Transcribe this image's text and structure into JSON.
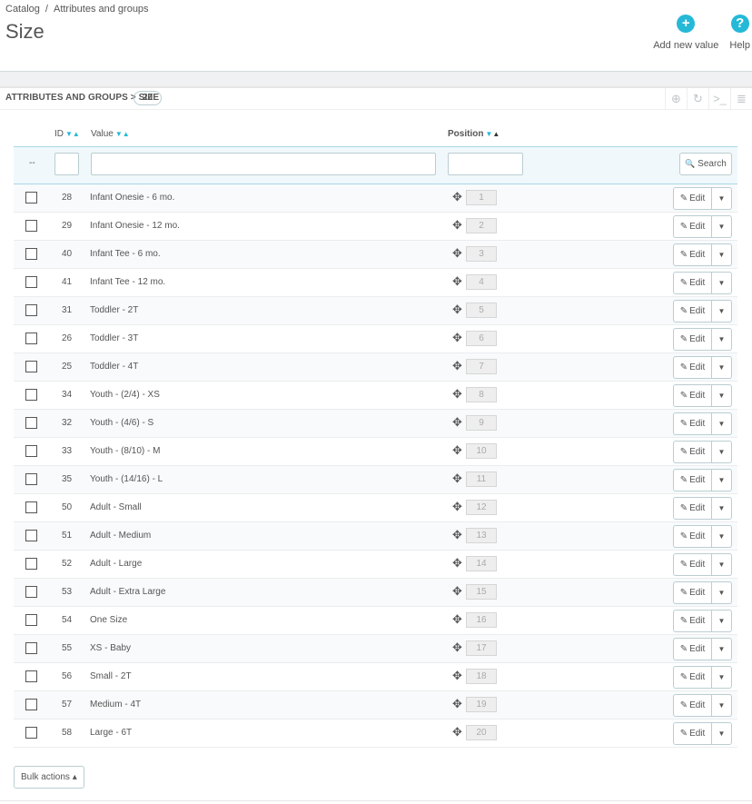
{
  "breadcrumb": {
    "items": [
      "Catalog",
      "Attributes and groups"
    ],
    "separator": "/"
  },
  "page": {
    "title": "Size"
  },
  "toolbar": {
    "add_label": "Add new value",
    "add_icon": "+",
    "help_label": "Help",
    "help_icon": "?"
  },
  "panel": {
    "title": "ATTRIBUTES AND GROUPS > SIZE",
    "count": "20",
    "actions": [
      {
        "name": "add-icon",
        "glyph": "⊕"
      },
      {
        "name": "refresh-icon",
        "glyph": "↻"
      },
      {
        "name": "sql-query-icon",
        "glyph": ">_"
      },
      {
        "name": "database-icon",
        "glyph": "≣"
      }
    ]
  },
  "table": {
    "headers": {
      "id": "ID",
      "value": "Value",
      "position": "Position"
    },
    "filter": {
      "dash": "--",
      "id_value": "",
      "value_value": "",
      "position_value": "",
      "search_label": "Search",
      "search_icon": "🔍"
    },
    "rows": [
      {
        "id": "28",
        "value": "Infant Onesie - 6 mo.",
        "position": "1"
      },
      {
        "id": "29",
        "value": "Infant Onesie - 12 mo.",
        "position": "2"
      },
      {
        "id": "40",
        "value": "Infant Tee - 6 mo.",
        "position": "3"
      },
      {
        "id": "41",
        "value": "Infant Tee - 12 mo.",
        "position": "4"
      },
      {
        "id": "31",
        "value": "Toddler - 2T",
        "position": "5"
      },
      {
        "id": "26",
        "value": "Toddler - 3T",
        "position": "6"
      },
      {
        "id": "25",
        "value": "Toddler - 4T",
        "position": "7"
      },
      {
        "id": "34",
        "value": "Youth - (2/4) - XS",
        "position": "8"
      },
      {
        "id": "32",
        "value": "Youth - (4/6) - S",
        "position": "9"
      },
      {
        "id": "33",
        "value": "Youth - (8/10) - M",
        "position": "10"
      },
      {
        "id": "35",
        "value": "Youth - (14/16) - L",
        "position": "11"
      },
      {
        "id": "50",
        "value": "Adult - Small",
        "position": "12"
      },
      {
        "id": "51",
        "value": "Adult - Medium",
        "position": "13"
      },
      {
        "id": "52",
        "value": "Adult - Large",
        "position": "14"
      },
      {
        "id": "53",
        "value": "Adult - Extra Large",
        "position": "15"
      },
      {
        "id": "54",
        "value": "One Size",
        "position": "16"
      },
      {
        "id": "55",
        "value": "XS - Baby",
        "position": "17"
      },
      {
        "id": "56",
        "value": "Small - 2T",
        "position": "18"
      },
      {
        "id": "57",
        "value": "Medium - 4T",
        "position": "19"
      },
      {
        "id": "58",
        "value": "Large - 6T",
        "position": "20"
      }
    ],
    "edit_label": "Edit"
  },
  "footer": {
    "bulk_label": "Bulk actions ▴"
  },
  "colors": {
    "accent": "#25b9d7",
    "filter_bg": "#f0f8fb",
    "border": "#bbcdd2"
  }
}
